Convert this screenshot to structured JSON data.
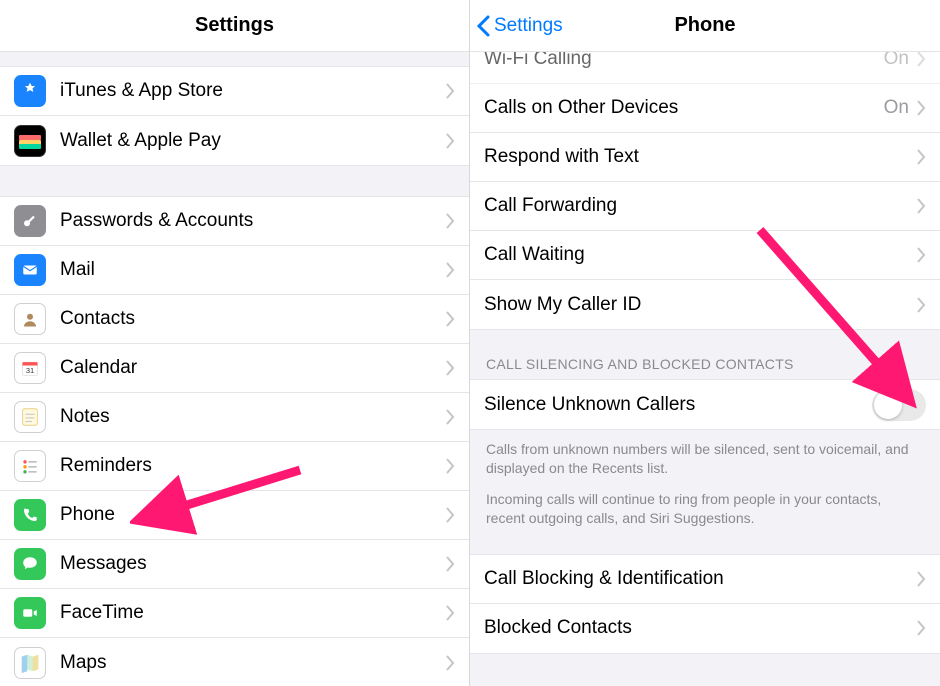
{
  "left": {
    "title": "Settings",
    "groups": [
      {
        "items": [
          {
            "icon": "appstore-icon",
            "color": "bg-blue",
            "glyph": "A",
            "label": "iTunes & App Store"
          },
          {
            "icon": "wallet-icon",
            "color": "bg-black",
            "glyph": "▬",
            "label": "Wallet & Apple Pay"
          }
        ]
      },
      {
        "items": [
          {
            "icon": "key-icon",
            "color": "bg-gray",
            "glyph": "🔑",
            "label": "Passwords & Accounts"
          },
          {
            "icon": "mail-icon",
            "color": "bg-blue",
            "glyph": "✉",
            "label": "Mail"
          },
          {
            "icon": "contacts-icon",
            "color": "bg-lightgray",
            "glyph": "👤",
            "label": "Contacts"
          },
          {
            "icon": "calendar-icon",
            "color": "bg-lightgray",
            "glyph": "📅",
            "label": "Calendar"
          },
          {
            "icon": "notes-icon",
            "color": "bg-lightgray",
            "glyph": "📝",
            "label": "Notes"
          },
          {
            "icon": "reminders-icon",
            "color": "bg-lightgray",
            "glyph": "☰",
            "label": "Reminders"
          },
          {
            "icon": "phone-icon",
            "color": "bg-green",
            "glyph": "📞",
            "label": "Phone"
          },
          {
            "icon": "messages-icon",
            "color": "bg-green",
            "glyph": "💬",
            "label": "Messages"
          },
          {
            "icon": "facetime-icon",
            "color": "bg-green",
            "glyph": "🎥",
            "label": "FaceTime"
          },
          {
            "icon": "maps-icon",
            "color": "bg-lightgray",
            "glyph": "🗺",
            "label": "Maps"
          }
        ]
      }
    ]
  },
  "right": {
    "back": "Settings",
    "title": "Phone",
    "rows1": [
      {
        "label": "Wi-Fi Calling",
        "value": "On"
      },
      {
        "label": "Calls on Other Devices",
        "value": "On"
      },
      {
        "label": "Respond with Text"
      },
      {
        "label": "Call Forwarding"
      },
      {
        "label": "Call Waiting"
      },
      {
        "label": "Show My Caller ID"
      }
    ],
    "section_header": "CALL SILENCING AND BLOCKED CONTACTS",
    "toggle_row": {
      "label": "Silence Unknown Callers",
      "on": false
    },
    "footer1": "Calls from unknown numbers will be silenced, sent to voicemail, and displayed on the Recents list.",
    "footer2": "Incoming calls will continue to ring from people in your contacts, recent outgoing calls, and Siri Suggestions.",
    "rows2": [
      {
        "label": "Call Blocking & Identification"
      },
      {
        "label": "Blocked Contacts"
      }
    ]
  },
  "annotation_color": "#ff1871"
}
